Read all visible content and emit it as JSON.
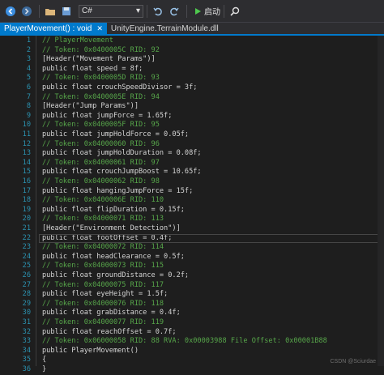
{
  "toolbar": {
    "language": "C#",
    "start_label": "启动",
    "icons": [
      "back-icon",
      "forward-icon",
      "open-folder-icon",
      "save-all-icon",
      "undo-icon",
      "redo-icon",
      "start-icon",
      "search-icon"
    ]
  },
  "tabs": [
    {
      "label": "PlayerMovement() : void",
      "close": "✕",
      "active": true
    },
    {
      "label": "UnityEngine.TerrainModule.dll",
      "active": false
    }
  ],
  "colors": {
    "accent": "#007acc",
    "comment": "#57a64a",
    "line_number": "#2b91af",
    "code": "#d4d4d4",
    "background": "#1e1e1e"
  },
  "code": {
    "current_line": 22,
    "lines": [
      {
        "num": "1",
        "text": "// PlayerMovement",
        "type": "comment"
      },
      {
        "num": "2",
        "text": "// Token: 0x0400005C RID: 92",
        "type": "comment"
      },
      {
        "num": "3",
        "text": "[Header(\"Movement Params\")]",
        "type": "code"
      },
      {
        "num": "4",
        "text": "public float speed = 8f;",
        "type": "code"
      },
      {
        "num": "5",
        "text": "// Token: 0x0400005D RID: 93",
        "type": "comment"
      },
      {
        "num": "6",
        "text": "public float crouchSpeedDivisor = 3f;",
        "type": "code"
      },
      {
        "num": "7",
        "text": "// Token: 0x0400005E RID: 94",
        "type": "comment"
      },
      {
        "num": "8",
        "text": "[Header(\"Jump Params\")]",
        "type": "code"
      },
      {
        "num": "9",
        "text": "public float jumpForce = 1.65f;",
        "type": "code"
      },
      {
        "num": "10",
        "text": "// Token: 0x0400005F RID: 95",
        "type": "comment"
      },
      {
        "num": "11",
        "text": "public float jumpHoldForce = 0.05f;",
        "type": "code"
      },
      {
        "num": "12",
        "text": "// Token: 0x04000060 RID: 96",
        "type": "comment"
      },
      {
        "num": "13",
        "text": "public float jumpHoldDuration = 0.08f;",
        "type": "code"
      },
      {
        "num": "14",
        "text": "// Token: 0x04000061 RID: 97",
        "type": "comment"
      },
      {
        "num": "15",
        "text": "public float crouchJumpBoost = 10.65f;",
        "type": "code"
      },
      {
        "num": "16",
        "text": "// Token: 0x04000062 RID: 98",
        "type": "comment"
      },
      {
        "num": "17",
        "text": "public float hangingJumpForce = 15f;",
        "type": "code"
      },
      {
        "num": "18",
        "text": "// Token: 0x0400006E RID: 110",
        "type": "comment"
      },
      {
        "num": "19",
        "text": "public float flipDuration = 0.15f;",
        "type": "code"
      },
      {
        "num": "20",
        "text": "// Token: 0x04000071 RID: 113",
        "type": "comment"
      },
      {
        "num": "21",
        "text": "[Header(\"Environment Detection\")]",
        "type": "code"
      },
      {
        "num": "22",
        "text": "public float footOffset = 0.4f;",
        "type": "code"
      },
      {
        "num": "23",
        "text": "// Token: 0x04000072 RID: 114",
        "type": "comment"
      },
      {
        "num": "24",
        "text": "public float headClearance = 0.5f;",
        "type": "code"
      },
      {
        "num": "25",
        "text": "// Token: 0x04000073 RID: 115",
        "type": "comment"
      },
      {
        "num": "26",
        "text": "public float groundDistance = 0.2f;",
        "type": "code"
      },
      {
        "num": "27",
        "text": "// Token: 0x04000075 RID: 117",
        "type": "comment"
      },
      {
        "num": "28",
        "text": "public float eyeHeight = 1.5f;",
        "type": "code"
      },
      {
        "num": "29",
        "text": "// Token: 0x04000076 RID: 118",
        "type": "comment"
      },
      {
        "num": "30",
        "text": "public float grabDistance = 0.4f;",
        "type": "code"
      },
      {
        "num": "31",
        "text": "// Token: 0x04000077 RID: 119",
        "type": "comment"
      },
      {
        "num": "32",
        "text": "public float reachOffset = 0.7f;",
        "type": "code"
      },
      {
        "num": "33",
        "text": "// Token: 0x06000058 RID: 88 RVA: 0x00003988 File Offset: 0x00001B88",
        "type": "comment"
      },
      {
        "num": "34",
        "text": "public PlayerMovement()",
        "type": "code"
      },
      {
        "num": "35",
        "text": "{",
        "type": "code"
      },
      {
        "num": "36",
        "text": "}",
        "type": "code"
      }
    ]
  },
  "watermark": "CSDN @Sciurdae"
}
